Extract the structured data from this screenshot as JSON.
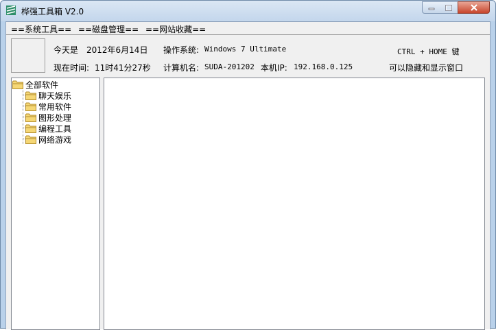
{
  "window": {
    "title": "桦强工具箱 V2.0"
  },
  "menu": {
    "items": [
      "==系统工具==",
      "==磁盘管理==",
      "==网站收藏=="
    ]
  },
  "info": {
    "today_label": "今天是",
    "today_value": "2012年6月14日",
    "time_label": "现在时间:",
    "time_value": "11时41分27秒",
    "os_label": "操作系统:",
    "os_value": "Windows 7 Ultimate",
    "computer_label": "计算机名:",
    "computer_value": "SUDA-201202",
    "ip_label": "本机IP:",
    "ip_value": "192.168.0.125",
    "hotkey_line1": "CTRL + HOME 键",
    "hotkey_line2": "可以隐藏和显示窗口"
  },
  "tree": {
    "root": "全部软件",
    "children": [
      "聊天娱乐",
      "常用软件",
      "图形处理",
      "编程工具",
      "网络游戏"
    ]
  },
  "icons": {
    "app": "app-icon",
    "folder": "folder-icon",
    "minimize": "minimize-icon",
    "maximize": "maximize-icon",
    "close": "close-icon"
  },
  "colors": {
    "window_frame": "#b9d1ea",
    "close_button": "#c8452c",
    "folder": "#f5d775"
  }
}
